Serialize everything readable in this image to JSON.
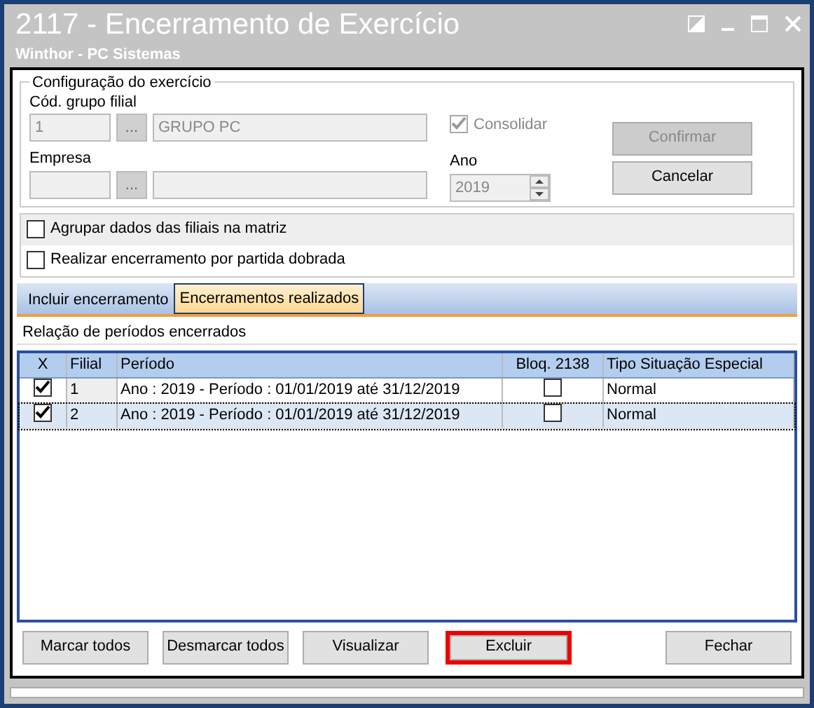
{
  "window": {
    "title": "2117 - Encerramento de Exercício",
    "subtitle": "Winthor - PC Sistemas"
  },
  "config": {
    "legend": "Configuração do exercício",
    "group_label": "Cód. grupo filial",
    "group_code": "1",
    "group_name": "GRUPO PC",
    "consolidar": {
      "label": "Consolidar",
      "checked": true,
      "disabled": true
    },
    "empresa_label": "Empresa",
    "ano_label": "Ano",
    "ano": "2019",
    "lookup": "...",
    "confirm": {
      "label": "Confirmar",
      "disabled": true
    },
    "cancel": {
      "label": "Cancelar",
      "disabled": false
    }
  },
  "options": [
    {
      "label": "Agrupar dados das filiais na matriz",
      "checked": false
    },
    {
      "label": "Realizar encerramento por partida dobrada",
      "checked": false
    }
  ],
  "tabs": [
    {
      "label": "Incluir encerramento",
      "selected": false
    },
    {
      "label": "Encerramentos realizados",
      "selected": true
    }
  ],
  "table": {
    "caption": "Relação de períodos encerrados",
    "columns": [
      "X",
      "Filial",
      "Período",
      "Bloq. 2138",
      "Tipo Situação Especial"
    ],
    "rows": [
      {
        "checked": true,
        "filial": "1",
        "periodo": "Ano : 2019 - Período : 01/01/2019 até 31/12/2019",
        "bloq": false,
        "tipo": "Normal",
        "selected": false
      },
      {
        "checked": true,
        "filial": "2",
        "periodo": "Ano : 2019 - Período : 01/01/2019 até 31/12/2019",
        "bloq": false,
        "tipo": "Normal",
        "selected": true
      }
    ]
  },
  "buttons": [
    {
      "label": "Marcar todos",
      "highlighted": false
    },
    {
      "label": "Desmarcar todos",
      "highlighted": false
    },
    {
      "label": "Visualizar",
      "highlighted": false
    },
    {
      "label": "Excluir",
      "highlighted": true
    },
    {
      "label": "Fechar",
      "highlighted": false
    }
  ]
}
